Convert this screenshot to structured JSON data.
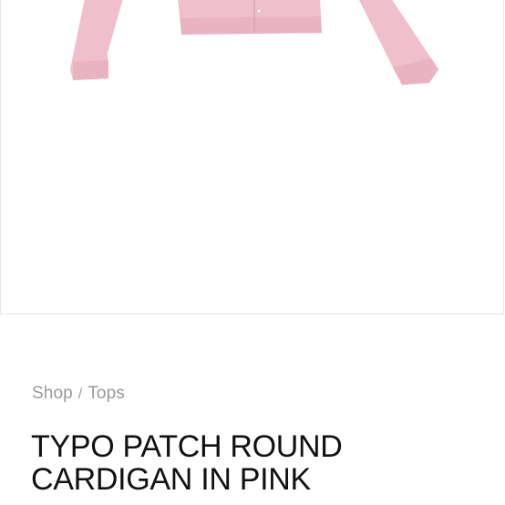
{
  "product_image": {
    "alt": "pink cardigan",
    "garment_color": "#efbfcb",
    "garment_shadow": "#e3aebb"
  },
  "breadcrumb": {
    "shop_label": "Shop",
    "separator": "/",
    "category_label": "Tops"
  },
  "product": {
    "title_line1": "TYPO PATCH ROUND",
    "title_line2": "CARDIGAN IN PINK"
  }
}
